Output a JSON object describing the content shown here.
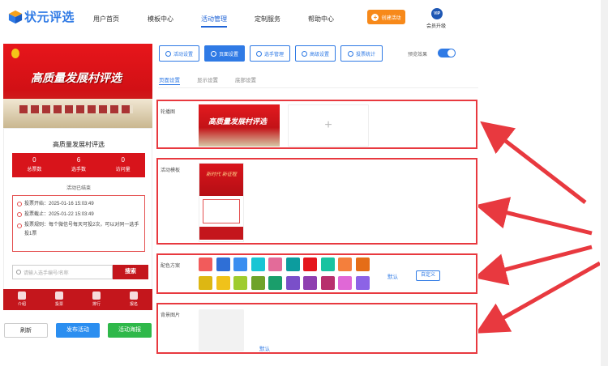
{
  "brand": {
    "name": "状元评选"
  },
  "nav": {
    "items": [
      "用户首页",
      "模板中心",
      "活动管理",
      "定制服务",
      "帮助中心"
    ],
    "active_index": 2,
    "create_label": "创建活动",
    "vip_badge": "VIP",
    "vip_label": "会员升级"
  },
  "preview": {
    "banner_title": "高质量发展村评选",
    "activity_name": "高质量发展村评选",
    "stats": [
      {
        "value": "0",
        "label": "总票数"
      },
      {
        "value": "6",
        "label": "选手数"
      },
      {
        "value": "0",
        "label": "访问量"
      }
    ],
    "status": "活动已结束",
    "rules": [
      "投票开始：2025-01-16 15:03:49",
      "投票截止：2025-01-22 15:03:49",
      "投票规则：每个微信号每天可投2次，可以对同一选手投1票"
    ],
    "search_placeholder": "请输入选手编号/名称",
    "search_button": "搜索",
    "bottom_nav": [
      "介绍",
      "投票",
      "排行",
      "报名"
    ]
  },
  "actions": {
    "refresh": "刷新",
    "publish": "发布活动",
    "poster": "活动海报"
  },
  "toolbar": {
    "buttons": [
      "活动设置",
      "页面设置",
      "选手管理",
      "高级设置",
      "投票统计"
    ],
    "active_index": 1,
    "preview_label": "预览效果",
    "preview_on": true
  },
  "subtabs": {
    "items": [
      "页面设置",
      "显示设置",
      "底部设置"
    ],
    "active_index": 0
  },
  "sections": {
    "carousel": {
      "label": "轮播图",
      "thumb_title": "高质量发展村评选"
    },
    "template": {
      "label": "活动模板",
      "thumb_title": "新时代 新征程"
    },
    "colors": {
      "label": "配色方案",
      "row1": [
        "#f25b5b",
        "#2f6fd6",
        "#3a8ef0",
        "#18c5d4",
        "#e36b99",
        "#0c9c9e",
        "#e5151c",
        "#19c3a0",
        "#f47f3c",
        "#e56d17"
      ],
      "row2": [
        "#ddb713",
        "#f0c21a",
        "#9fcc2e",
        "#6fa32a",
        "#1a9e6b",
        "#7a4fc9",
        "#8e3fb0",
        "#b8306d",
        "#e068d6",
        "#8c63e6"
      ],
      "default_label": "默认",
      "custom_label": "自定义"
    },
    "background": {
      "label": "背景图片",
      "default_label": "默认"
    }
  }
}
